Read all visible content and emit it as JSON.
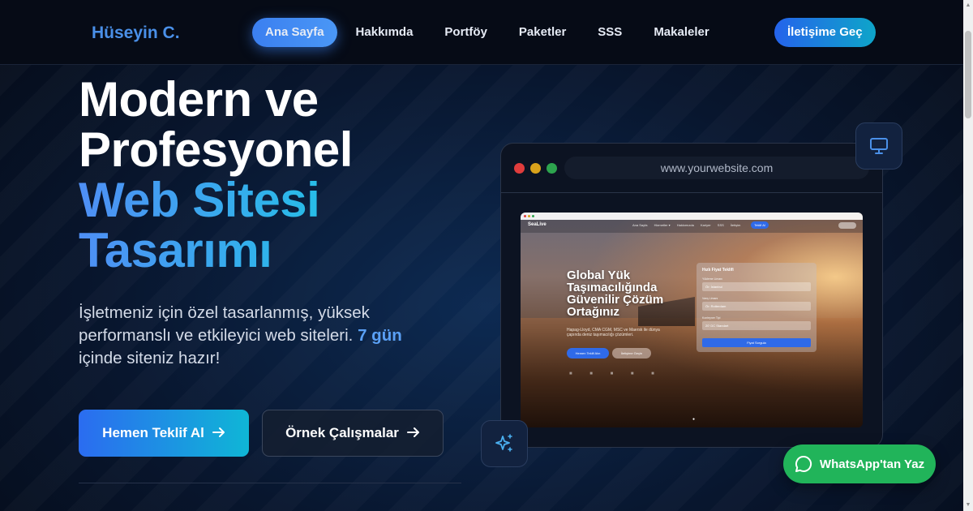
{
  "header": {
    "logo": "Hüseyin C.",
    "nav": [
      "Ana Sayfa",
      "Hakkımda",
      "Portföy",
      "Paketler",
      "SSS",
      "Makaleler"
    ],
    "active_nav": "Ana Sayfa",
    "cta": "İletişime Geç"
  },
  "hero": {
    "title_line1": "Modern ve",
    "title_line2": "Profesyonel",
    "title_line3": "Web Sitesi",
    "title_line4": "Tasarımı",
    "desc_part1": "İşletmeniz için özel tasarlanmış, yüksek performanslı ve etkileyici web siteleri.",
    "desc_highlight": "7 gün",
    "desc_part2": "içinde siteniz hazır!",
    "primary_button": "Hemen Teklif Al",
    "secondary_button": "Örnek Çalışmalar"
  },
  "mockup": {
    "url": "www.yourwebsite.com",
    "site_logo": "SeaLive",
    "site_nav": [
      "Ana Sayfa",
      "Hizmetler ▾",
      "Hakkımızda",
      "Kariyer",
      "SSS",
      "İletişim"
    ],
    "site_cta": "Teklif Al",
    "site_title_line1": "Global Yük",
    "site_title_line2": "Taşımacılığında",
    "site_title_line3": "Güvenilir Çözüm",
    "site_title_line4": "Ortağınız",
    "site_subtitle": "Hapag-Lloyd, CMA CGM, MSC ve Maersk ile dünya çapında deniz taşımacılığı çözümleri.",
    "site_button1": "Hemen Teklif Alın",
    "site_button2": "İletişime Geçin",
    "form_title": "Hızlı Fiyat Teklifi",
    "form_field1_label": "Yükleme Limanı",
    "form_field1_value": "Ör: İstanbul",
    "form_field2_label": "Varış Limanı",
    "form_field2_value": "Ör: Rotterdam",
    "form_field3_label": "Konteyner Tipi",
    "form_field3_value": "20' DC Standart",
    "form_submit": "Fiyat Sorgula"
  },
  "whatsapp": "WhatsApp'tan Yaz",
  "colors": {
    "accent": "#3b7ff0",
    "accent_cyan": "#22c3e6",
    "whatsapp": "#21b45a",
    "background": "#08162e"
  },
  "icons": {
    "monitor": "monitor-icon",
    "sparkles": "sparkles-icon",
    "whatsapp": "whatsapp-icon",
    "arrow": "arrow-right-icon"
  }
}
